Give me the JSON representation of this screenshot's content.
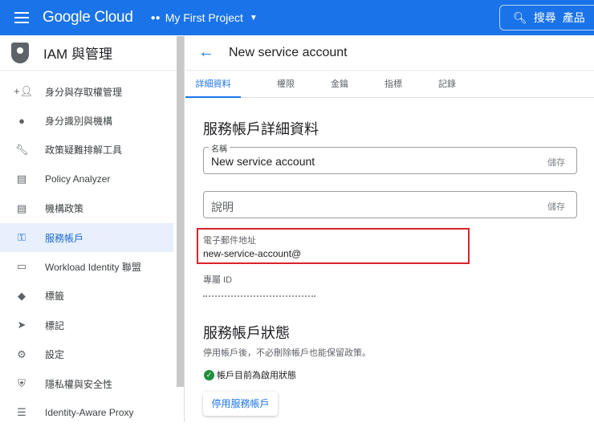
{
  "header": {
    "brand": "Google Cloud",
    "project": "My First Project",
    "search_label": "搜尋",
    "search_scope": "產品"
  },
  "sidebar": {
    "title": "IAM 與管理",
    "items": [
      {
        "label": "身分與存取權管理",
        "icon": "person-add-icon"
      },
      {
        "label": "身分識別與機構",
        "icon": "account-circle-icon"
      },
      {
        "label": "政策疑難排解工具",
        "icon": "wrench-icon"
      },
      {
        "label": "Policy Analyzer",
        "icon": "document-search-icon"
      },
      {
        "label": "機構政策",
        "icon": "list-icon"
      },
      {
        "label": "服務帳戶",
        "icon": "service-account-icon",
        "active": true
      },
      {
        "label": "Workload Identity 聯盟",
        "icon": "id-card-icon"
      },
      {
        "label": "標籤",
        "icon": "tag-icon"
      },
      {
        "label": "標記",
        "icon": "label-icon"
      },
      {
        "label": "設定",
        "icon": "gear-icon"
      },
      {
        "label": "隱私權與安全性",
        "icon": "shield-icon"
      },
      {
        "label": "Identity-Aware Proxy",
        "icon": "proxy-icon"
      }
    ]
  },
  "main": {
    "title": "New service account",
    "tabs": [
      "詳細資料",
      "權限",
      "金鑰",
      "指標",
      "記錄"
    ],
    "details_heading": "服務帳戶詳細資料",
    "name_label": "名稱",
    "name_value": "New service account",
    "save": "儲存",
    "description_placeholder": "說明",
    "email_label": "電子郵件地址",
    "email_value": "new-service-account@",
    "unique_id_label": "專屬 ID",
    "status_heading": "服務帳戶狀態",
    "status_desc": "停用帳戶後，不必刪除帳戶也能保留政策。",
    "status_text": "帳戶目前為啟用狀態",
    "disable_button": "停用服務帳戶"
  },
  "colors": {
    "brand": "#1a73e8",
    "highlight": "#d9232e",
    "success": "#1e8e3e"
  }
}
